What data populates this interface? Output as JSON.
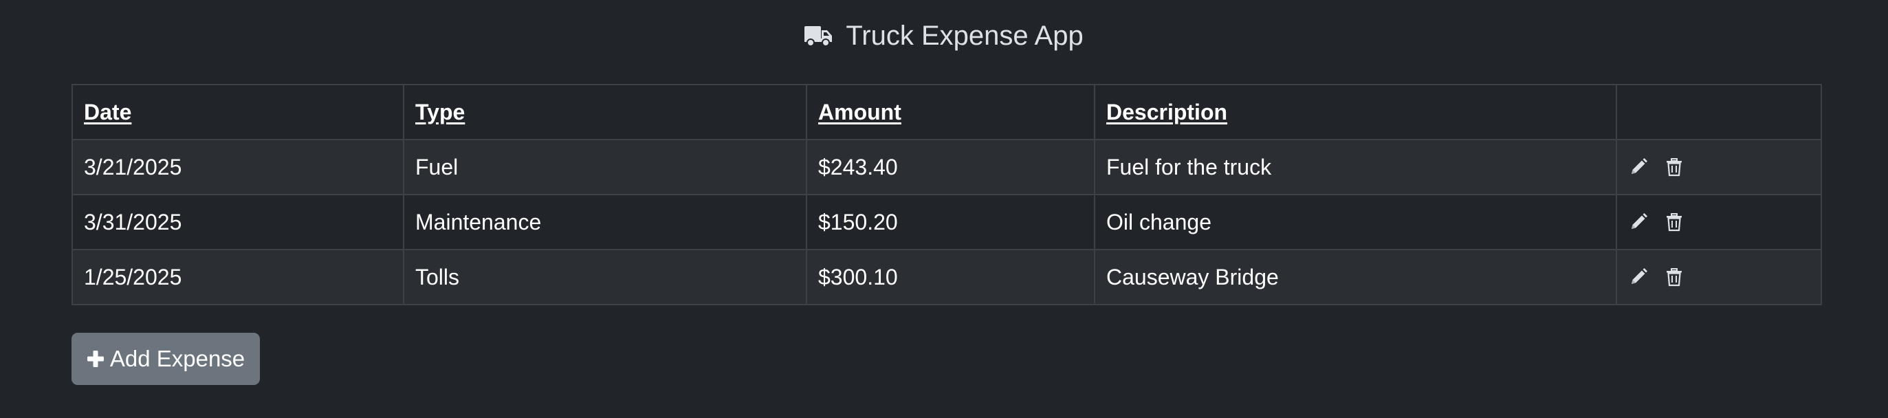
{
  "app": {
    "title": "Truck Expense App",
    "title_icon": "truck-icon"
  },
  "table": {
    "headers": {
      "date": "Date",
      "type": "Type",
      "amount": "Amount",
      "description": "Description"
    },
    "rows": [
      {
        "date": "3/21/2025",
        "type": "Fuel",
        "amount": "$243.40",
        "description": "Fuel for the truck"
      },
      {
        "date": "3/31/2025",
        "type": "Maintenance",
        "amount": "$150.20",
        "description": "Oil change"
      },
      {
        "date": "1/25/2025",
        "type": "Tolls",
        "amount": "$300.10",
        "description": "Causeway Bridge"
      }
    ],
    "row_actions": [
      "pencil-icon",
      "trash-icon"
    ]
  },
  "add_button": {
    "label": "Add Expense",
    "icon": "plus-icon"
  },
  "colors": {
    "background": "#212529",
    "row_stripe": "#2b2f33",
    "border": "#3d4247",
    "button": "#6c757d",
    "title_text": "#dee2e6"
  }
}
